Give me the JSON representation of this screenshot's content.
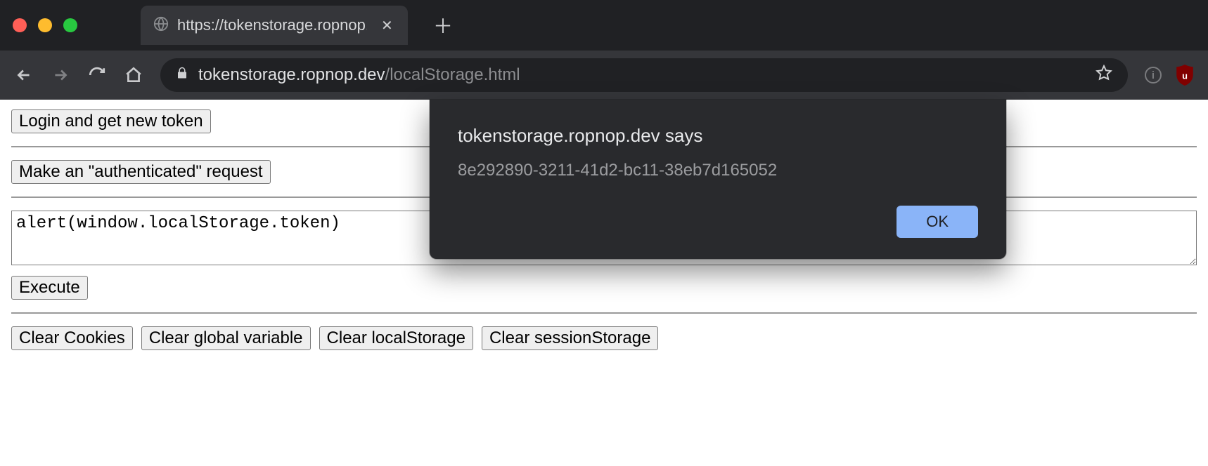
{
  "browser": {
    "tab_title": "https://tokenstorage.ropnop.de",
    "omnibox": {
      "domain": "tokenstorage.ropnop.dev",
      "path": "/localStorage.html"
    }
  },
  "page": {
    "login_button": "Login and get new token",
    "auth_request_button": "Make an \"authenticated\" request",
    "payload_value": "alert(window.localStorage.token)",
    "execute_button": "Execute",
    "clear_buttons": {
      "cookies": "Clear Cookies",
      "global": "Clear global variable",
      "local": "Clear localStorage",
      "session": "Clear sessionStorage"
    }
  },
  "alert": {
    "title": "tokenstorage.ropnop.dev says",
    "message": "8e292890-3211-41d2-bc11-38eb7d165052",
    "ok_label": "OK"
  }
}
